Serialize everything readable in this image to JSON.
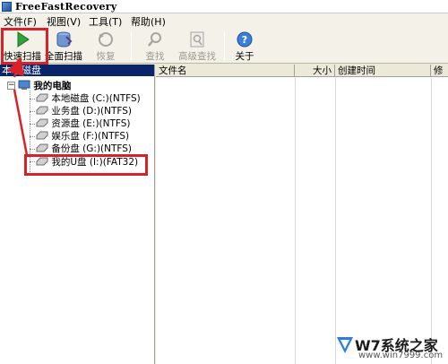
{
  "window": {
    "title": "FreeFastRecovery"
  },
  "menu": [
    "文件(F)",
    "视图(V)",
    "工具(T)",
    "帮助(H)"
  ],
  "toolbar": {
    "quick_scan": "快速扫描",
    "full_scan": "全面扫描",
    "recover": "恢复",
    "search": "查找",
    "advanced_search": "高级查找",
    "about": "关于"
  },
  "left_panel": {
    "header": "本地磁盘",
    "root": "我的电脑",
    "drives": [
      "本地磁盘 (C:)(NTFS)",
      "业务盘 (D:)(NTFS)",
      "资源盘 (E:)(NTFS)",
      "娱乐盘 (F:)(NTFS)",
      "备份盘 (G:)(NTFS)",
      "我的U盘 (I:)(FAT32)"
    ]
  },
  "file_list": {
    "columns": [
      "文件名",
      "大小",
      "创建时间",
      "修"
    ]
  },
  "watermark": {
    "text": "W7系统之家",
    "url": "www.win7999.com"
  },
  "colors": {
    "highlight_red": "#d8222a",
    "panel_header_bg": "#0a246a",
    "play_green": "#2fa33a"
  }
}
